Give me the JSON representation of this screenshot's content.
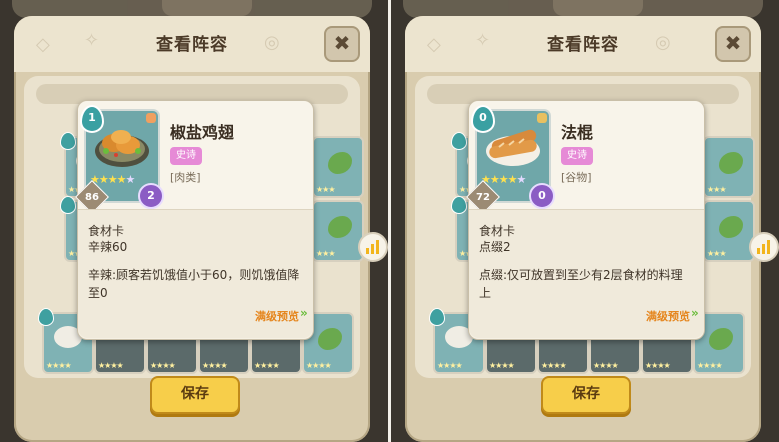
{
  "panels": [
    {
      "title": "查看阵容",
      "close_glyph": "✖",
      "save_label": "保存",
      "card": {
        "cost_top": "1",
        "name": "椒盐鸡翅",
        "rarity": "史诗",
        "category": "[肉类]",
        "stars": "★★★★",
        "empty_stars": "★",
        "bottom_left": "86",
        "bottom_right": "2",
        "type": "食材卡",
        "stat": "辛辣60",
        "description": "辛辣:顾客若饥饿值小于60，则饥饿值降至0",
        "max_level": "满级预览",
        "food_icon": "chicken-wings-icon"
      }
    },
    {
      "title": "查看阵容",
      "close_glyph": "✖",
      "save_label": "保存",
      "card": {
        "cost_top": "0",
        "name": "法棍",
        "rarity": "史诗",
        "category": "[谷物]",
        "stars": "★★★★",
        "empty_stars": "★",
        "bottom_left": "72",
        "bottom_right": "0",
        "type": "食材卡",
        "stat": "点缀2",
        "description": "点缀:仅可放置到至少有2层食材的料理上",
        "max_level": "满级预览",
        "food_icon": "baguette-icon"
      }
    }
  ],
  "colors": {
    "accent_yellow": "#f7ce4a",
    "rarity_pink": "#e68ad6",
    "card_teal": "#6fa7a9",
    "max_level_orange": "#e5861e"
  }
}
